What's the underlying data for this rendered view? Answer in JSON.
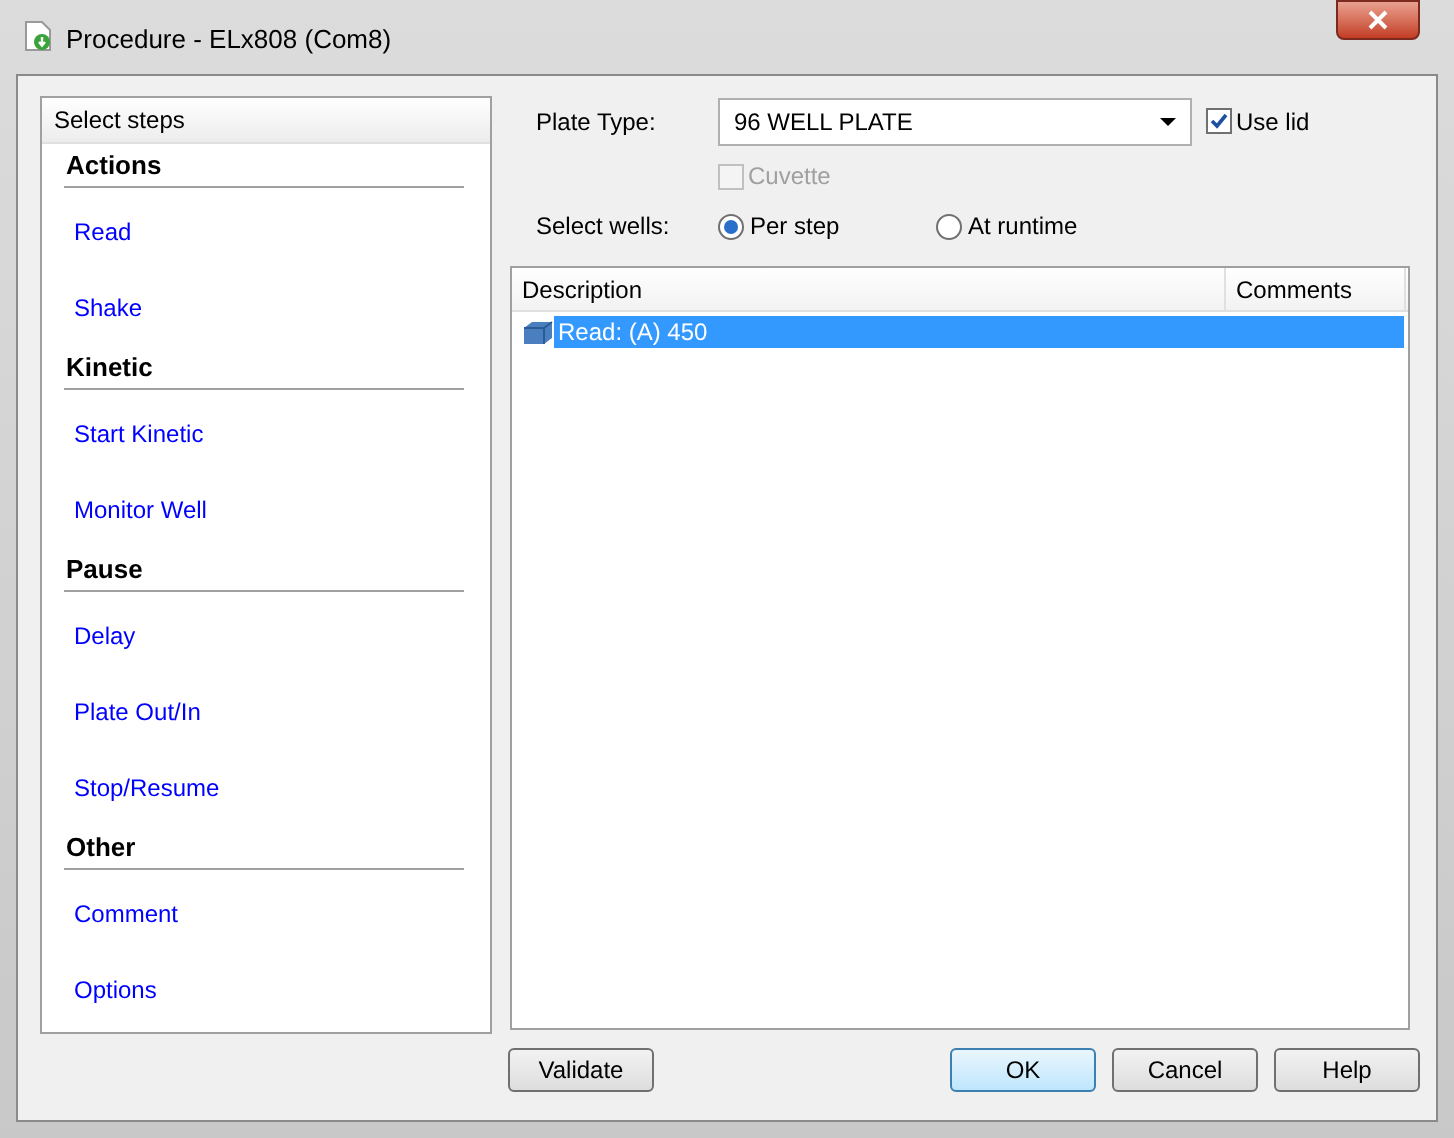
{
  "window": {
    "title": "Procedure - ELx808 (Com8)"
  },
  "steps_panel": {
    "header": "Select steps",
    "groups": [
      {
        "heading": "Actions",
        "items": [
          "Read",
          "Shake"
        ]
      },
      {
        "heading": "Kinetic",
        "items": [
          "Start Kinetic",
          "Monitor Well"
        ]
      },
      {
        "heading": "Pause",
        "items": [
          "Delay",
          "Plate Out/In",
          "Stop/Resume"
        ]
      },
      {
        "heading": "Other",
        "items": [
          "Comment",
          "Options"
        ]
      }
    ]
  },
  "plate_type": {
    "label": "Plate Type:",
    "value": "96 WELL PLATE"
  },
  "use_lid": {
    "label": "Use lid",
    "checked": true,
    "disabled": false
  },
  "cuvette": {
    "label": "Cuvette",
    "checked": false,
    "disabled": true
  },
  "select_wells": {
    "label": "Select wells:",
    "options": [
      {
        "label": "Per step",
        "selected": true
      },
      {
        "label": "At runtime",
        "selected": false
      }
    ]
  },
  "table": {
    "columns": [
      "Description",
      "Comments"
    ],
    "rows": [
      {
        "description": "Read:  (A) 450",
        "selected": true
      }
    ]
  },
  "buttons": [
    {
      "label": "Validate",
      "default": false
    },
    {
      "label": "OK",
      "default": true
    },
    {
      "label": "Cancel",
      "default": false
    },
    {
      "label": "Help",
      "default": false
    }
  ]
}
